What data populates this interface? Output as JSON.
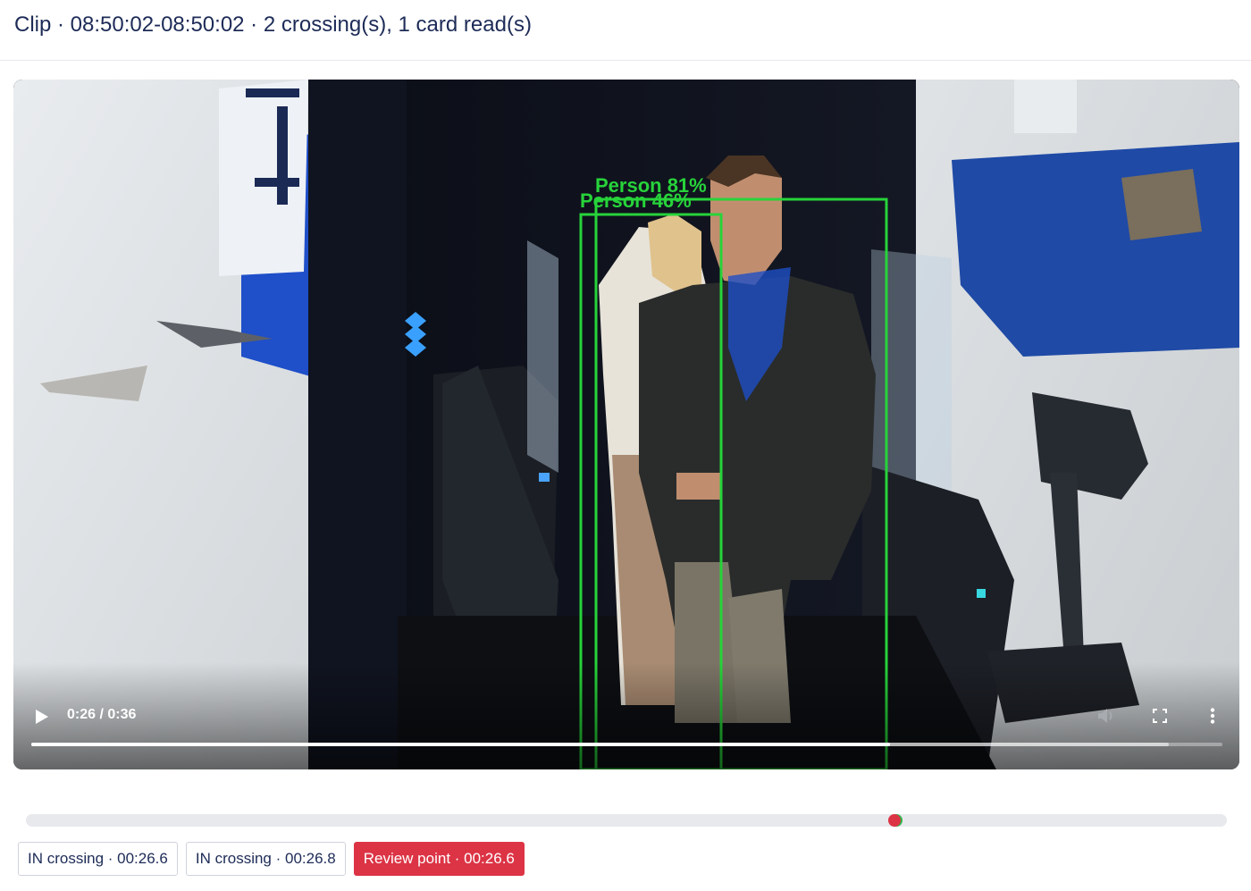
{
  "header": {
    "title": "Clip · 08:50:02-08:50:02 · 2 crossing(s), 1 card read(s)"
  },
  "video": {
    "time_display": "0:26 / 0:36",
    "progress": 0.721,
    "buffered": 0.955,
    "detections": [
      {
        "label": "Person 81%"
      },
      {
        "label": "Person 46%"
      }
    ],
    "detection_color": "#27d33a"
  },
  "timeline": {
    "markers": [
      {
        "position": 0.725,
        "color": "#2fb84a",
        "kind": "crossing"
      },
      {
        "position": 0.723,
        "color": "#dc3445",
        "kind": "review"
      }
    ]
  },
  "events": [
    {
      "label": "IN crossing · 00:26.6",
      "style": "outline"
    },
    {
      "label": "IN crossing · 00:26.8",
      "style": "outline"
    },
    {
      "label": "Review point · 00:26.6",
      "style": "solid"
    }
  ],
  "colors": {
    "title": "#1d2b57",
    "review": "#dc3445",
    "chip_border": "#cfd3dc"
  }
}
